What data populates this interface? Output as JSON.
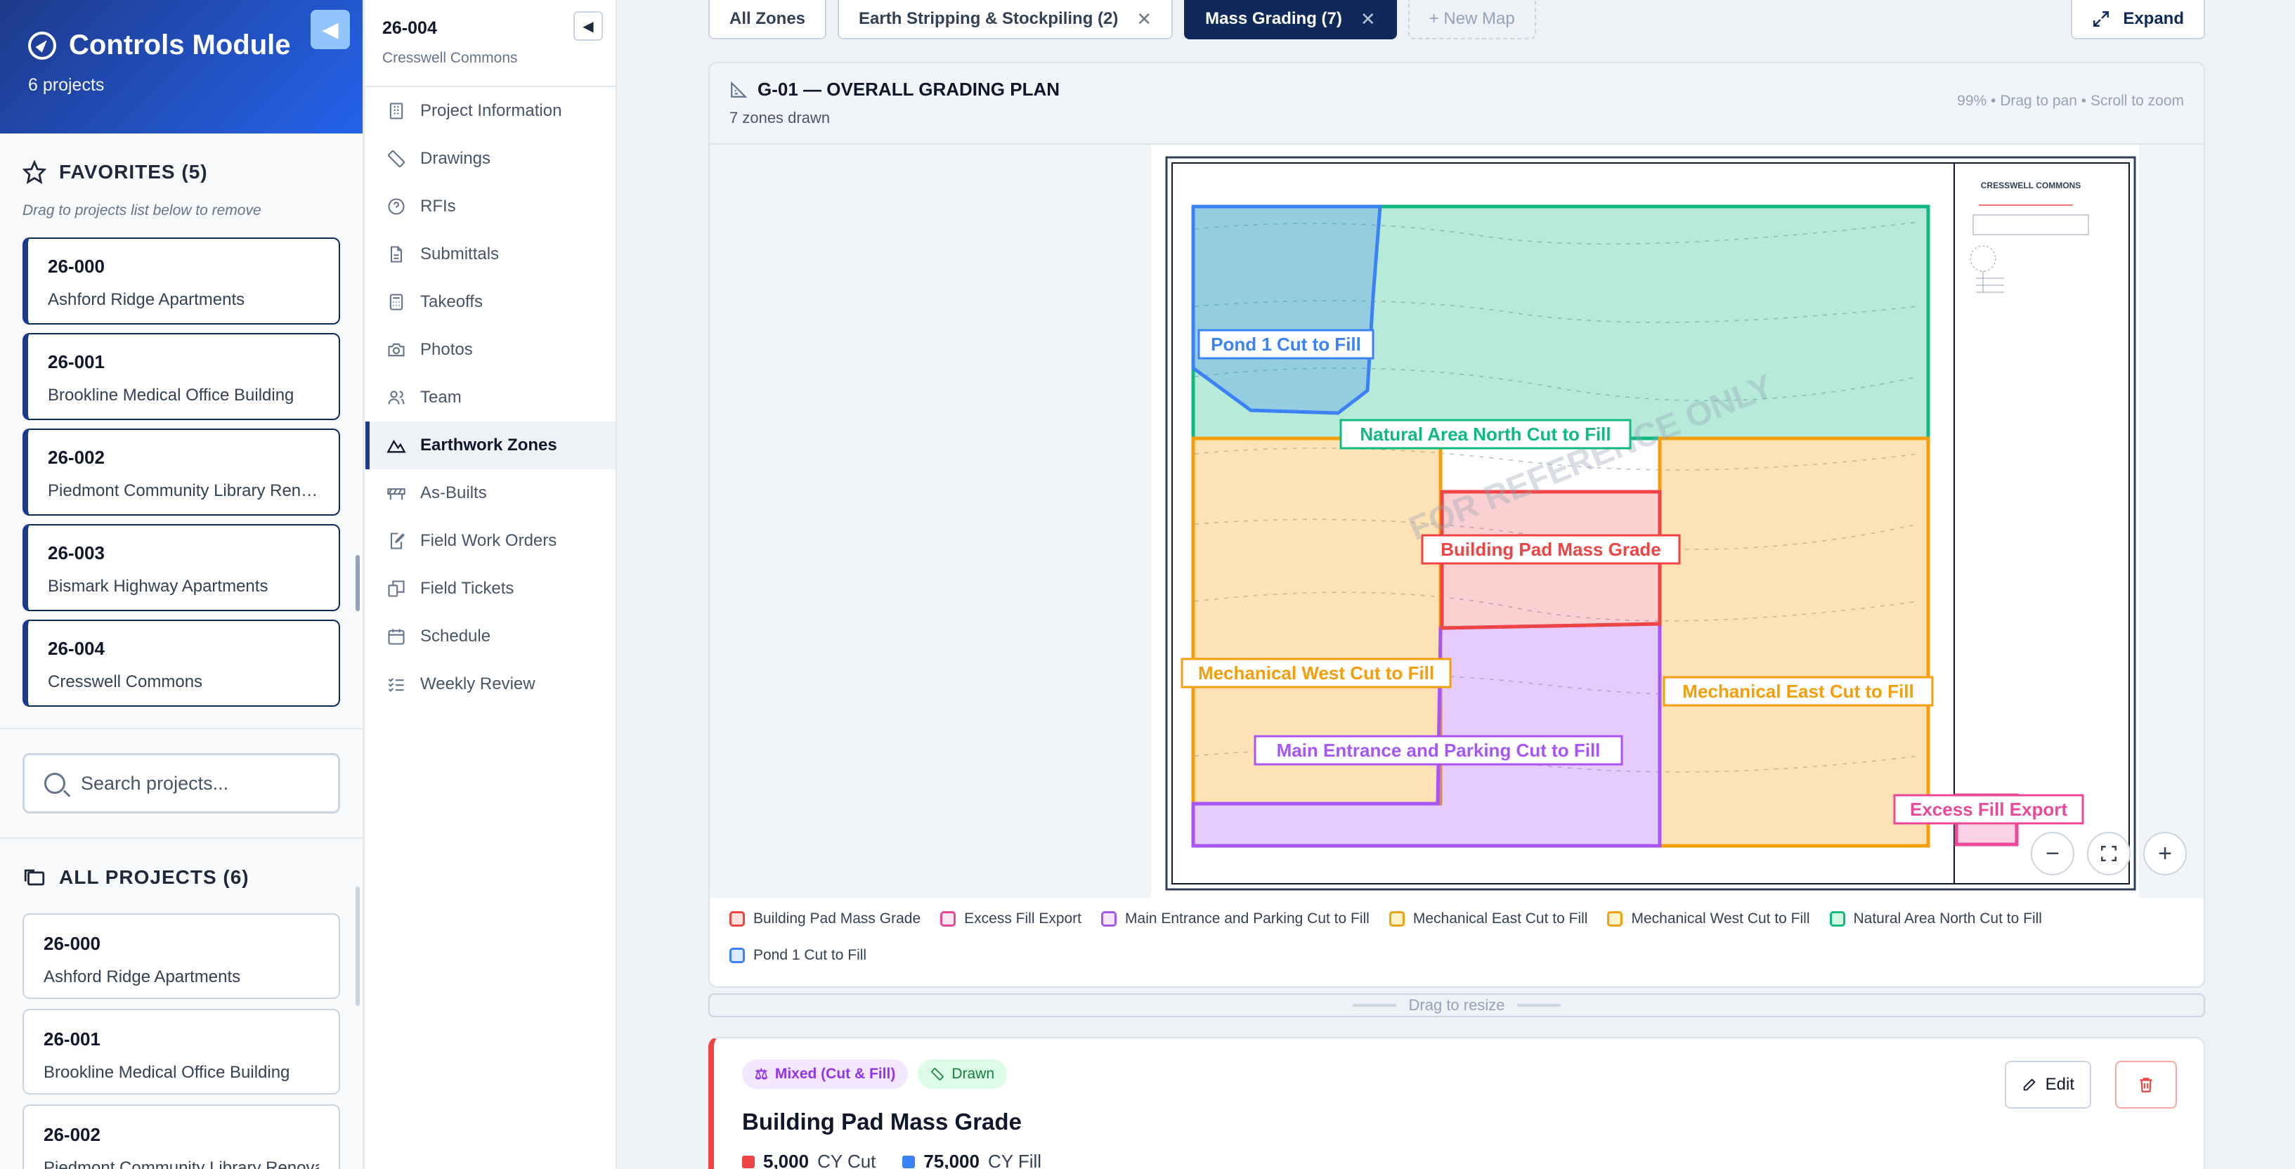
{
  "sidebar": {
    "title": "Controls Module",
    "subtitle": "6 projects",
    "favorites_heading": "FAVORITES (5)",
    "favorites_hint": "Drag to projects list below to remove",
    "favorites": [
      {
        "code": "26-000",
        "name": "Ashford Ridge Apartments"
      },
      {
        "code": "26-001",
        "name": "Brookline Medical Office Building"
      },
      {
        "code": "26-002",
        "name": "Piedmont Community Library Renovation"
      },
      {
        "code": "26-003",
        "name": "Bismark Highway Apartments"
      },
      {
        "code": "26-004",
        "name": "Cresswell Commons"
      }
    ],
    "search_placeholder": "Search projects...",
    "all_heading": "ALL PROJECTS (6)",
    "all_projects": [
      {
        "code": "26-000",
        "name": "Ashford Ridge Apartments"
      },
      {
        "code": "26-001",
        "name": "Brookline Medical Office Building"
      },
      {
        "code": "26-002",
        "name": "Piedmont Community Library Renovation"
      }
    ]
  },
  "nav": {
    "project_code": "26-004",
    "project_name": "Cresswell Commons",
    "items": [
      {
        "label": "Project Information",
        "icon": "building-icon"
      },
      {
        "label": "Drawings",
        "icon": "ruler-icon"
      },
      {
        "label": "RFIs",
        "icon": "question-icon"
      },
      {
        "label": "Submittals",
        "icon": "document-icon"
      },
      {
        "label": "Takeoffs",
        "icon": "calculator-icon"
      },
      {
        "label": "Photos",
        "icon": "camera-icon"
      },
      {
        "label": "Team",
        "icon": "users-icon"
      },
      {
        "label": "Earthwork Zones",
        "icon": "mountain-icon",
        "active": true
      },
      {
        "label": "As-Builts",
        "icon": "barrier-icon"
      },
      {
        "label": "Field Work Orders",
        "icon": "clipboard-edit-icon"
      },
      {
        "label": "Field Tickets",
        "icon": "ticket-icon"
      },
      {
        "label": "Schedule",
        "icon": "calendar-icon"
      },
      {
        "label": "Weekly Review",
        "icon": "checklist-icon"
      }
    ]
  },
  "tabs": [
    {
      "label": "All Zones",
      "closable": false
    },
    {
      "label": "Earth Stripping & Stockpiling (2)",
      "closable": true
    },
    {
      "label": "Mass Grading (7)",
      "closable": true,
      "active": true
    }
  ],
  "new_map_label": "+ New Map",
  "expand_label": "Expand",
  "map": {
    "title": "G-01 — OVERALL GRADING PLAN",
    "subtitle": "7 zones drawn",
    "help": "99% • Drag to pan • Scroll to zoom",
    "watermark": "FOR REFERENCE ONLY",
    "sheet_title": "CRESSWELL COMMONS",
    "zones": [
      {
        "label": "Pond 1 Cut to Fill",
        "color": "#3b82f6"
      },
      {
        "label": "Natural Area North Cut to Fill",
        "color": "#10b981"
      },
      {
        "label": "Building Pad Mass Grade",
        "color": "#ef4444"
      },
      {
        "label": "Mechanical West Cut to Fill",
        "color": "#f59e0b"
      },
      {
        "label": "Mechanical East Cut to Fill",
        "color": "#f59e0b"
      },
      {
        "label": "Main Entrance and Parking Cut to Fill",
        "color": "#a855f7"
      },
      {
        "label": "Excess Fill Export",
        "color": "#ec4899"
      }
    ]
  },
  "legend": [
    {
      "label": "Building Pad Mass Grade",
      "color": "#ef4444"
    },
    {
      "label": "Excess Fill Export",
      "color": "#ec4899"
    },
    {
      "label": "Main Entrance and Parking Cut to Fill",
      "color": "#a855f7"
    },
    {
      "label": "Mechanical East Cut to Fill",
      "color": "#f59e0b"
    },
    {
      "label": "Mechanical West Cut to Fill",
      "color": "#f59e0b"
    },
    {
      "label": "Natural Area North Cut to Fill",
      "color": "#10b981"
    },
    {
      "label": "Pond 1 Cut to Fill",
      "color": "#3b82f6"
    }
  ],
  "resize_label": "Drag to resize",
  "zone_card": {
    "badge_type": "Mixed (Cut & Fill)",
    "badge_status": "Drawn",
    "title": "Building Pad Mass Grade",
    "cut_value": "5,000",
    "cut_unit": "CY Cut",
    "fill_value": "75,000",
    "fill_unit": "CY Fill",
    "edit_label": "Edit"
  }
}
